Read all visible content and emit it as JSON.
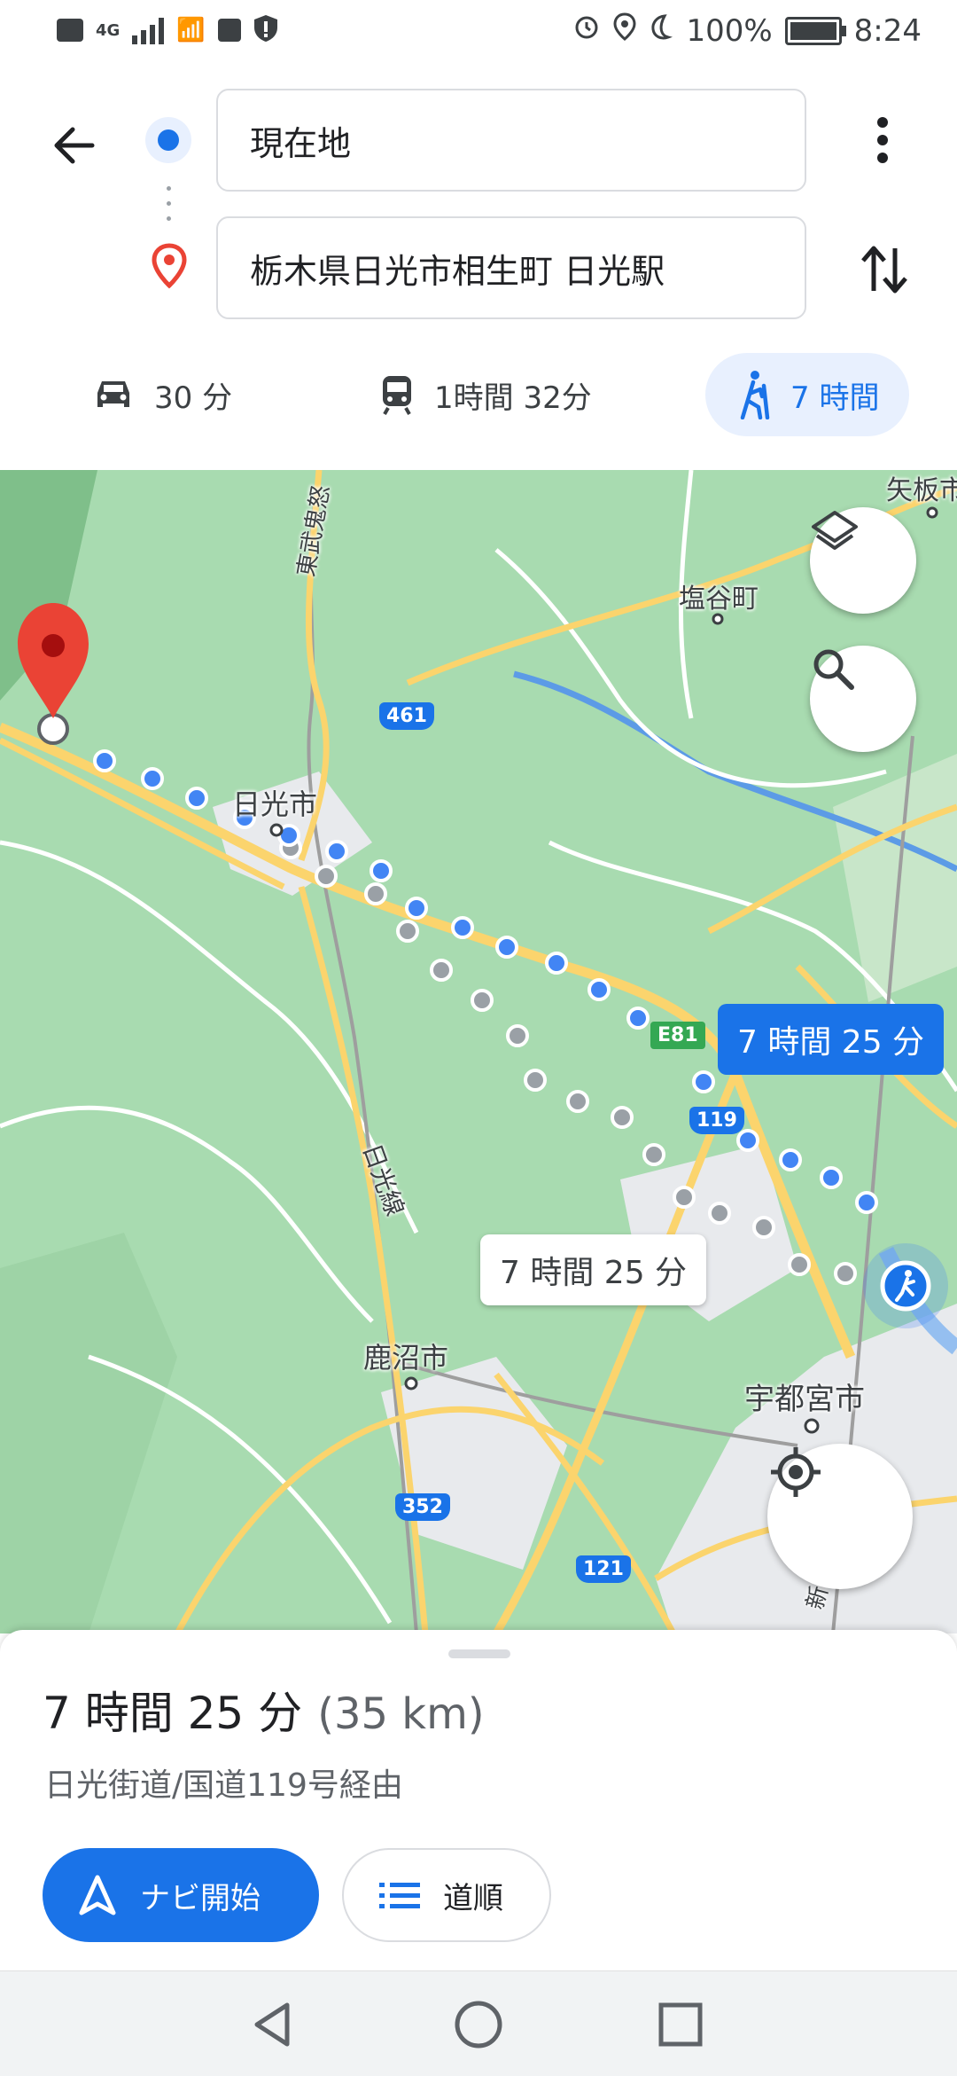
{
  "status_bar": {
    "left_icons": [
      "hd-icon",
      "signal-4g-icon",
      "wifi-calling-icon",
      "app-icon",
      "shield-alert-icon"
    ],
    "network_label": "4G",
    "battery_percent": "100%",
    "time": "8:24"
  },
  "header": {
    "origin": "現在地",
    "destination": "栃木県日光市相生町 日光駅",
    "modes": [
      {
        "icon": "car-icon",
        "label": "30 分",
        "active": false
      },
      {
        "icon": "train-icon",
        "label": "1時間 32分",
        "active": false
      },
      {
        "icon": "hiking-icon",
        "label": "7 時間",
        "active": true
      }
    ]
  },
  "map": {
    "labels": {
      "yaita": "矢板市",
      "shioya": "塩谷町",
      "nikko_city": "日光市",
      "kanuma": "鹿沼市",
      "utsunomiya": "宇都宮市",
      "tobu_line": "東武鬼怒",
      "nikko_line": "日光線",
      "shinkansen": "新幹"
    },
    "shields": {
      "r461": "461",
      "e81": "E81",
      "r119": "119",
      "r352": "352",
      "r121": "121"
    },
    "callout_primary": "7 時間 25 分",
    "callout_secondary": "7 時間 25 分"
  },
  "sheet": {
    "duration": "7 時間 25 分",
    "distance": "(35 km)",
    "via": "日光街道/国道119号経由",
    "start_label": "ナビ開始",
    "steps_label": "道順"
  },
  "colors": {
    "accent": "#1a73e8",
    "route_primary": "#4285f4",
    "route_alt": "#9aa0a6",
    "pin": "#ea4335",
    "map_green": "#a8dbb0",
    "road": "#fbd46d"
  }
}
